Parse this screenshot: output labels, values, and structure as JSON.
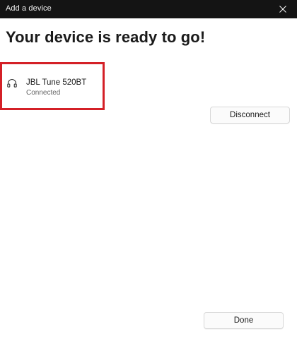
{
  "window": {
    "title": "Add a device",
    "close_icon": "close-icon"
  },
  "heading": "Your device is ready to go!",
  "device": {
    "icon": "headphones-icon",
    "name": "JBL Tune 520BT",
    "status": "Connected",
    "highlight_color": "#d42027"
  },
  "buttons": {
    "disconnect_label": "Disconnect",
    "done_label": "Done"
  }
}
